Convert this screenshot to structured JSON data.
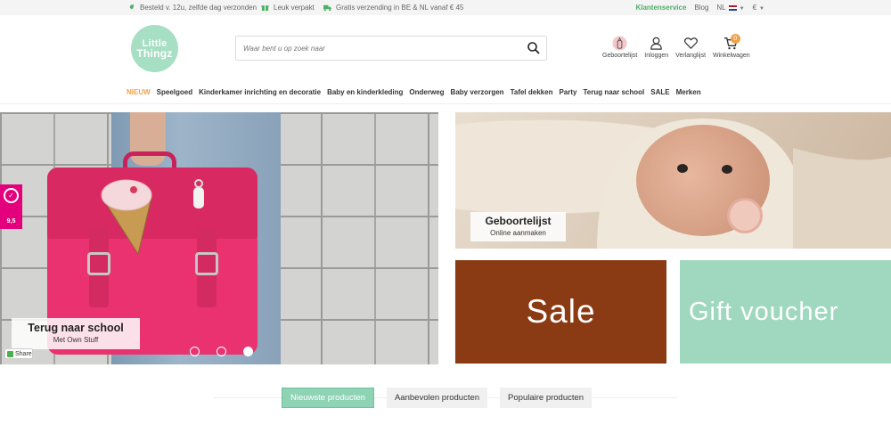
{
  "topbar": {
    "usps": [
      {
        "icon": "rocket-icon",
        "text": "Besteld v. 12u, zelfde dag verzonden"
      },
      {
        "icon": "gift-icon",
        "text": "Leuk verpakt"
      },
      {
        "icon": "truck-icon",
        "text": "Gratis verzending in BE & NL vanaf € 45"
      }
    ],
    "customer_service": "Klantenservice",
    "blog": "Blog",
    "language": "NL",
    "currency": "€"
  },
  "header": {
    "logo_line1": "Little",
    "logo_line2": "Thingz",
    "search_placeholder": "Waar bent u op zoek naar",
    "icons": [
      {
        "name": "birthlist",
        "label": "Geboortelijst"
      },
      {
        "name": "login",
        "label": "Inloggen"
      },
      {
        "name": "wishlist",
        "label": "Verlanglijst"
      },
      {
        "name": "cart",
        "label": "Winkelwagen"
      }
    ],
    "cart_count": "0"
  },
  "nav": {
    "items": [
      "NIEUW",
      "Speelgoed",
      "Kinderkamer inrichting en decoratie",
      "Baby en kinderkleding",
      "Onderweg",
      "Baby verzorgen",
      "Tafel dekken",
      "Party",
      "Terug naar school",
      "SALE",
      "Merken"
    ]
  },
  "hero": {
    "title": "Terug naar school",
    "subtitle": "Met Own Stuff",
    "share": "Share",
    "rating": "9,5"
  },
  "tiles": {
    "baby_title": "Geboortelijst",
    "baby_subtitle": "Online aanmaken",
    "sale": "Sale",
    "gift": "Gift voucher"
  },
  "product_tabs": [
    "Nieuwste producten",
    "Aanbevolen producten",
    "Populaire producten"
  ],
  "colors": {
    "accent_orange": "#f0a24a",
    "mint": "#a0d8bf",
    "sale_brown": "#8b3b14",
    "green": "#4caf64"
  }
}
